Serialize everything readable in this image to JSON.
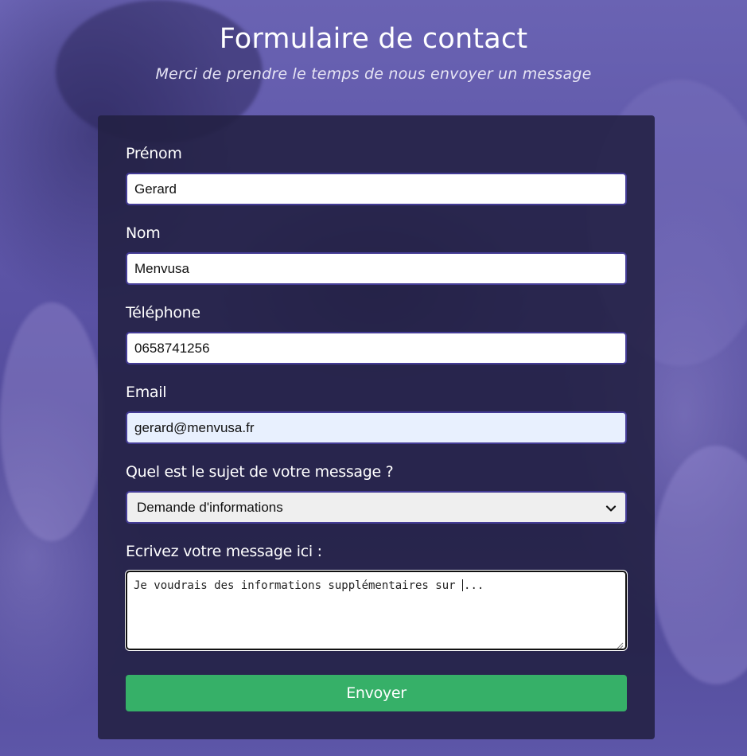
{
  "header": {
    "title": "Formulaire de contact",
    "subtitle": "Merci de prendre le temps de nous envoyer un message"
  },
  "form": {
    "first_name": {
      "label": "Prénom",
      "value": "Gerard"
    },
    "last_name": {
      "label": "Nom",
      "value": "Menvusa"
    },
    "phone": {
      "label": "Téléphone",
      "value": "0658741256"
    },
    "email": {
      "label": "Email",
      "value": "gerard@menvusa.fr"
    },
    "subject": {
      "label": "Quel est le sujet de votre message ?",
      "selected": "Demande d'informations"
    },
    "message": {
      "label": "Ecrivez votre message ici :",
      "value_before_caret": "Je voudrais des informations supplémentaires sur ",
      "value_after_caret": "..."
    },
    "submit_label": "Envoyer"
  },
  "colors": {
    "submit_button": "#36b068",
    "input_border": "#443c96",
    "card_background": "#222042",
    "page_background": "#5b54a6"
  },
  "icons": {
    "select_arrow": "chevron-down-icon",
    "textarea_resize": "resize-grip-icon"
  }
}
